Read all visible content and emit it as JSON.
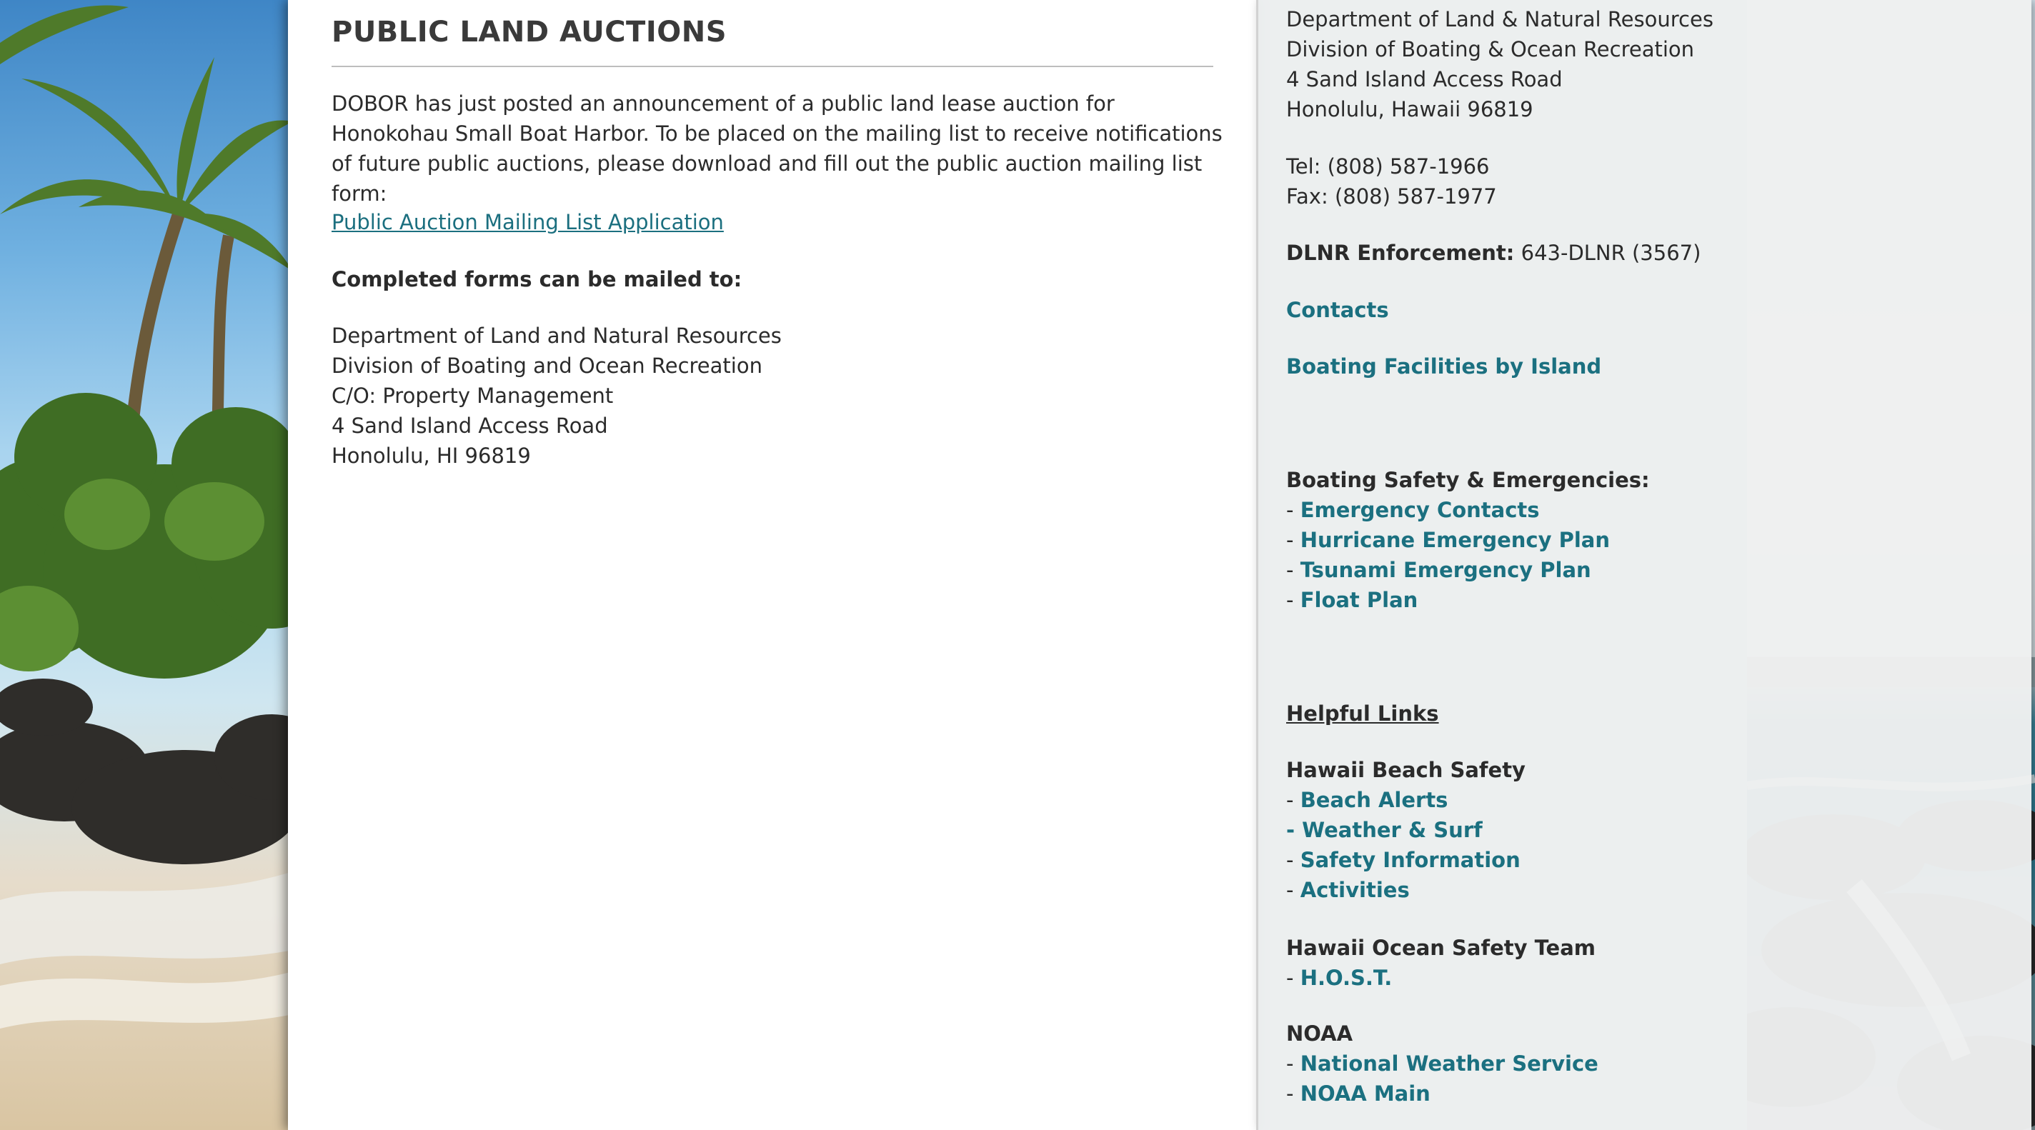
{
  "main": {
    "title": "PUBLIC LAND AUCTIONS",
    "intro": "DOBOR has just posted an announcement of a public land lease auction for Honokohau Small Boat Harbor.  To be placed on the mailing list to receive notifications of future public auctions, please download and fill out the public auction mailing list form:",
    "mailing_link": "Public Auction Mailing List Application",
    "mail_heading": "Completed forms can be mailed to:",
    "address": [
      "Department of Land and Natural Resources",
      "Division of Boating and Ocean Recreation",
      "C/O: Property Management",
      "4 Sand Island Access Road",
      "Honolulu, HI 96819"
    ]
  },
  "sidebar": {
    "address": [
      "Department of Land & Natural Resources",
      "Division of Boating & Ocean Recreation",
      "4 Sand Island Access Road",
      "Honolulu, Hawaii 96819"
    ],
    "tel": "Tel: (808) 587-1966",
    "fax": "Fax: (808) 587-1977",
    "enforcement_label": "DLNR Enforcement:",
    "enforcement_value": " 643-DLNR (3567)",
    "contacts": "Contacts",
    "facilities": "Boating Facilities by Island",
    "safety_heading": "Boating Safety & Emergencies:",
    "safety_links": [
      "Emergency Contacts",
      "Hurricane Emergency Plan",
      "Tsunami Emergency Plan",
      "Float Plan"
    ],
    "helpful_heading": "Helpful Links",
    "beach_heading": "Hawaii Beach Safety",
    "beach_links": [
      "Beach Alerts",
      "Weather & Surf",
      "Safety Information",
      "Activities"
    ],
    "host_heading": "Hawaii Ocean Safety Team",
    "host_links": [
      "H.O.S.T."
    ],
    "noaa_heading": "NOAA",
    "noaa_links": [
      "National Weather Service",
      "NOAA Main"
    ],
    "dash": "- "
  },
  "colors": {
    "link": "#1b7080",
    "text": "#2b2b2b",
    "sidebar_bg": "#eeeff0"
  }
}
